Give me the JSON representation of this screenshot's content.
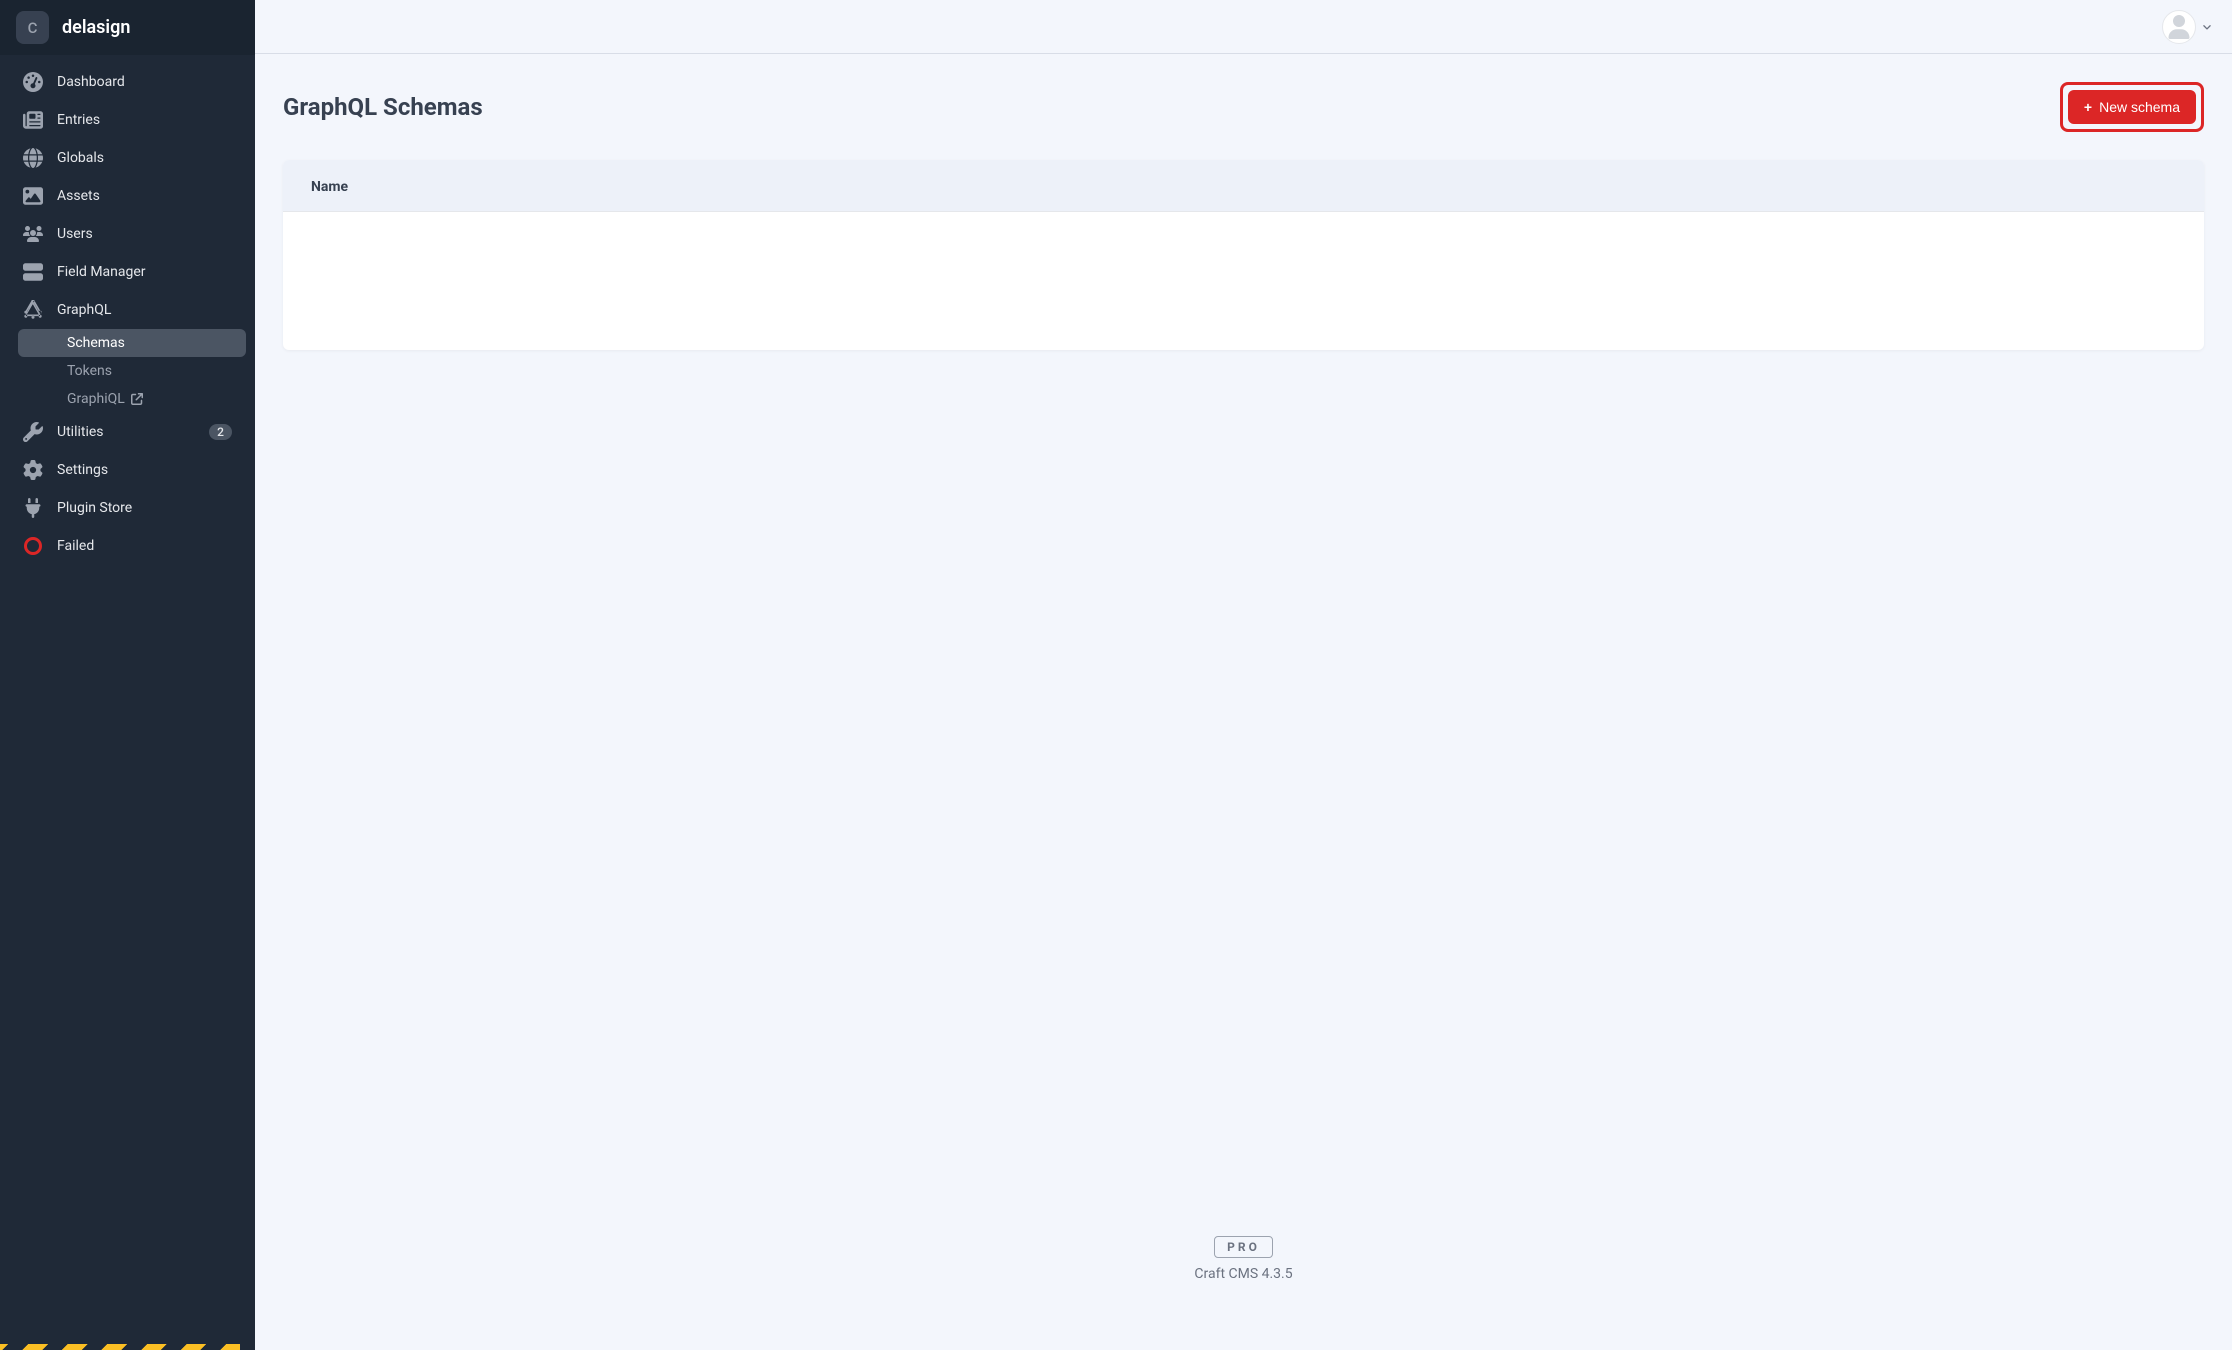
{
  "site": {
    "icon_letter": "C",
    "name": "delasign"
  },
  "sidebar": {
    "items": [
      {
        "label": "Dashboard"
      },
      {
        "label": "Entries"
      },
      {
        "label": "Globals"
      },
      {
        "label": "Assets"
      },
      {
        "label": "Users"
      },
      {
        "label": "Field Manager"
      },
      {
        "label": "GraphQL"
      },
      {
        "label": "Utilities",
        "badge": "2"
      },
      {
        "label": "Settings"
      },
      {
        "label": "Plugin Store"
      },
      {
        "label": "Failed"
      }
    ],
    "graphql_sub": [
      {
        "label": "Schemas"
      },
      {
        "label": "Tokens"
      },
      {
        "label": "GraphiQL"
      }
    ]
  },
  "page": {
    "title": "GraphQL Schemas",
    "new_button": "New schema",
    "table": {
      "col_name": "Name"
    }
  },
  "footer": {
    "edition": "PRO",
    "version": "Craft CMS 4.3.5"
  }
}
